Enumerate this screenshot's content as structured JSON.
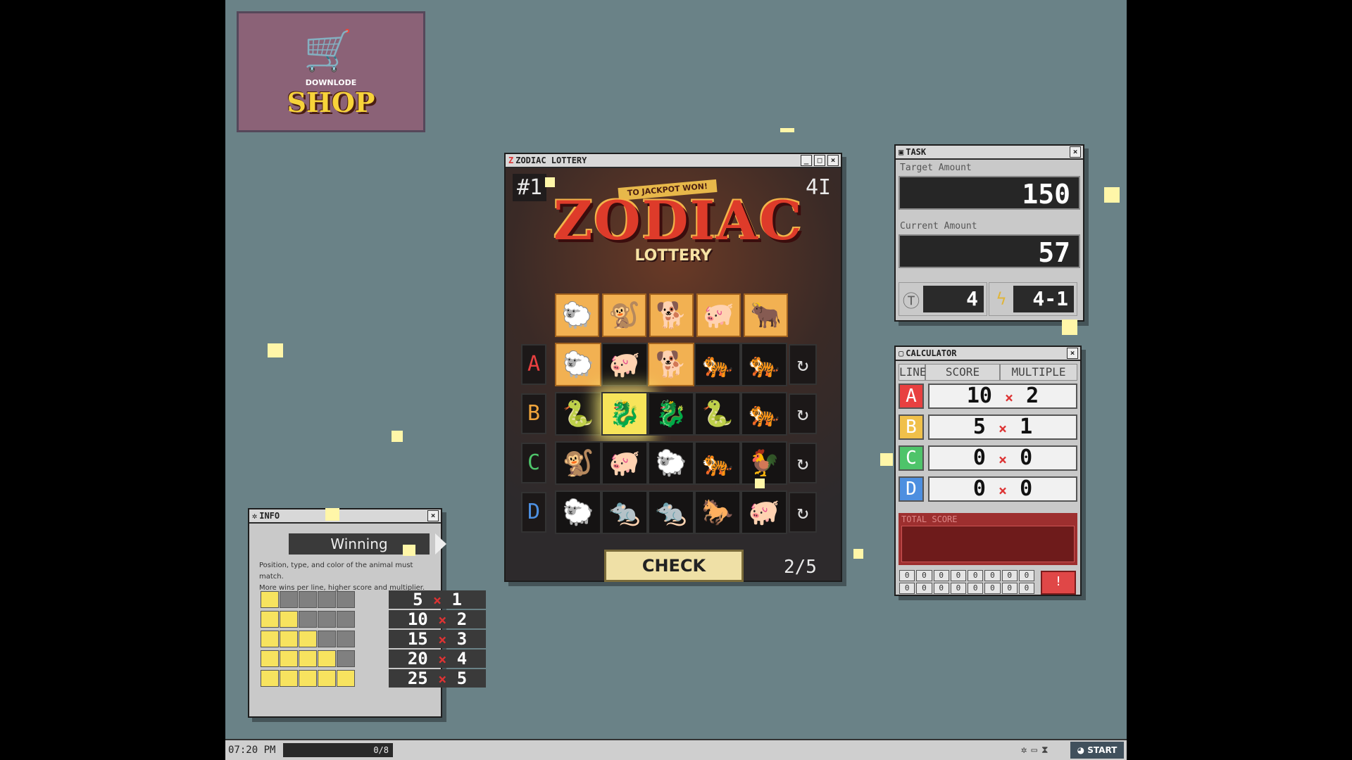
{
  "shop": {
    "brand": "DOWNLODE",
    "label": "SHOP"
  },
  "lottery": {
    "title": "ZODIAC LOTTERY",
    "draw_number": "#1",
    "top_right": "4I",
    "banner": "TO JACKPOT WON!",
    "logo": "ZODIAC",
    "logo_sub": "LOTTERY",
    "check_label": "CHECK",
    "pager": "2/5",
    "rows": [
      "A",
      "B",
      "C",
      "D"
    ],
    "row_colors": {
      "A": "#e84040",
      "B": "#f0a53c",
      "C": "#4ec46a",
      "D": "#4d8fe0"
    }
  },
  "task": {
    "title": "TASK",
    "target_label": "Target Amount",
    "target_value": "150",
    "current_label": "Current Amount",
    "current_value": "57",
    "tickets": "4",
    "stage": "4-1",
    "ticket_icon": "ticket-icon",
    "stage_icon": "lightning-icon"
  },
  "calculator": {
    "title": "CALCULATOR",
    "col_line": "LINE",
    "col_score": "SCORE",
    "col_multiple": "MULTIPLE",
    "rows": [
      {
        "line": "A",
        "score": "10",
        "multiple": "2"
      },
      {
        "line": "B",
        "score": "5",
        "multiple": "1"
      },
      {
        "line": "C",
        "score": "0",
        "multiple": "0"
      },
      {
        "line": "D",
        "score": "0",
        "multiple": "0"
      }
    ],
    "mult_sign": "×",
    "total_label": "TOTAL SCORE",
    "digits_row1": [
      "0",
      "0",
      "0",
      "0",
      "0",
      "0",
      "0",
      "0"
    ],
    "digits_row2": [
      "0",
      "0",
      "0",
      "0",
      "0",
      "0",
      "0",
      "0"
    ],
    "alert": "!"
  },
  "info": {
    "title": "INFO",
    "header": "Winning",
    "desc1": "Position, type, and color of the animal must match.",
    "desc2": "More wins per line, higher score and multiplier.",
    "rows": [
      {
        "score": "5",
        "multiple": "1",
        "wins": 1
      },
      {
        "score": "10",
        "multiple": "2",
        "wins": 2
      },
      {
        "score": "15",
        "multiple": "3",
        "wins": 3
      },
      {
        "score": "20",
        "multiple": "4",
        "wins": 4
      },
      {
        "score": "25",
        "multiple": "5",
        "wins": 5
      }
    ],
    "mult_sign": "×"
  },
  "taskbar": {
    "clock": "07:20 PM",
    "progress": "0/8",
    "start": "START"
  }
}
